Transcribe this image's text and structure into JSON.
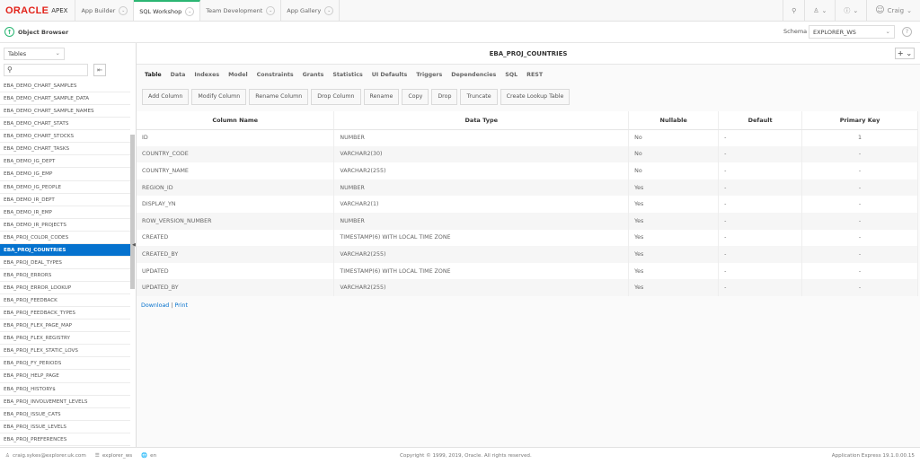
{
  "header": {
    "logo": "ORACLE",
    "logo_sub": "APEX",
    "tabs": [
      {
        "label": "App Builder"
      },
      {
        "label": "SQL Workshop",
        "active": true
      },
      {
        "label": "Team Development"
      },
      {
        "label": "App Gallery"
      }
    ],
    "user": "Craig",
    "accent": "#2bb673"
  },
  "subheader": {
    "breadcrumb": "Object Browser",
    "schema_label": "Schema",
    "schema_value": "EXPLORER_WS"
  },
  "sidebar": {
    "type_select": "Tables",
    "search_placeholder": "",
    "selected_color": "#0572ce",
    "items": [
      "EBA_DEMO_CHART_SAMPLES",
      "EBA_DEMO_CHART_SAMPLE_DATA",
      "EBA_DEMO_CHART_SAMPLE_NAMES",
      "EBA_DEMO_CHART_STATS",
      "EBA_DEMO_CHART_STOCKS",
      "EBA_DEMO_CHART_TASKS",
      "EBA_DEMO_IG_DEPT",
      "EBA_DEMO_IG_EMP",
      "EBA_DEMO_IG_PEOPLE",
      "EBA_DEMO_IR_DEPT",
      "EBA_DEMO_IR_EMP",
      "EBA_DEMO_IR_PROJECTS",
      "EBA_PROJ_COLOR_CODES",
      "EBA_PROJ_COUNTRIES",
      "EBA_PROJ_DEAL_TYPES",
      "EBA_PROJ_ERRORS",
      "EBA_PROJ_ERROR_LOOKUP",
      "EBA_PROJ_FEEDBACK",
      "EBA_PROJ_FEEDBACK_TYPES",
      "EBA_PROJ_FLEX_PAGE_MAP",
      "EBA_PROJ_FLEX_REGISTRY",
      "EBA_PROJ_FLEX_STATIC_LOVS",
      "EBA_PROJ_FY_PERIODS",
      "EBA_PROJ_HELP_PAGE",
      "EBA_PROJ_HISTORY$",
      "EBA_PROJ_INVOLVEMENT_LEVELS",
      "EBA_PROJ_ISSUE_CATS",
      "EBA_PROJ_ISSUE_LEVELS",
      "EBA_PROJ_PREFERENCES"
    ],
    "selected_index": 13
  },
  "main": {
    "title": "EBA_PROJ_COUNTRIES",
    "add_button": "+",
    "tabs": [
      "Table",
      "Data",
      "Indexes",
      "Model",
      "Constraints",
      "Grants",
      "Statistics",
      "UI Defaults",
      "Triggers",
      "Dependencies",
      "SQL",
      "REST"
    ],
    "active_tab": "Table",
    "actions": [
      "Add Column",
      "Modify Column",
      "Rename Column",
      "Drop Column",
      "Rename",
      "Copy",
      "Drop",
      "Truncate",
      "Create Lookup Table"
    ],
    "columns": [
      "Column Name",
      "Data Type",
      "Nullable",
      "Default",
      "Primary Key"
    ],
    "rows": [
      [
        "ID",
        "NUMBER",
        "No",
        "-",
        "1"
      ],
      [
        "COUNTRY_CODE",
        "VARCHAR2(30)",
        "No",
        "-",
        "-"
      ],
      [
        "COUNTRY_NAME",
        "VARCHAR2(255)",
        "No",
        "-",
        "-"
      ],
      [
        "REGION_ID",
        "NUMBER",
        "Yes",
        "-",
        "-"
      ],
      [
        "DISPLAY_YN",
        "VARCHAR2(1)",
        "Yes",
        "-",
        "-"
      ],
      [
        "ROW_VERSION_NUMBER",
        "NUMBER",
        "Yes",
        "-",
        "-"
      ],
      [
        "CREATED",
        "TIMESTAMP(6) WITH LOCAL TIME ZONE",
        "Yes",
        "-",
        "-"
      ],
      [
        "CREATED_BY",
        "VARCHAR2(255)",
        "Yes",
        "-",
        "-"
      ],
      [
        "UPDATED",
        "TIMESTAMP(6) WITH LOCAL TIME ZONE",
        "Yes",
        "-",
        "-"
      ],
      [
        "UPDATED_BY",
        "VARCHAR2(255)",
        "Yes",
        "-",
        "-"
      ]
    ],
    "download": "Download",
    "separator": "|",
    "print": "Print"
  },
  "footer": {
    "user": "craig.sykes@explorer.uk.com",
    "workspace": "explorer_ws",
    "language": "en",
    "copyright": "Copyright © 1999, 2019, Oracle. All rights reserved.",
    "version": "Application Express 19.1.0.00.15"
  }
}
